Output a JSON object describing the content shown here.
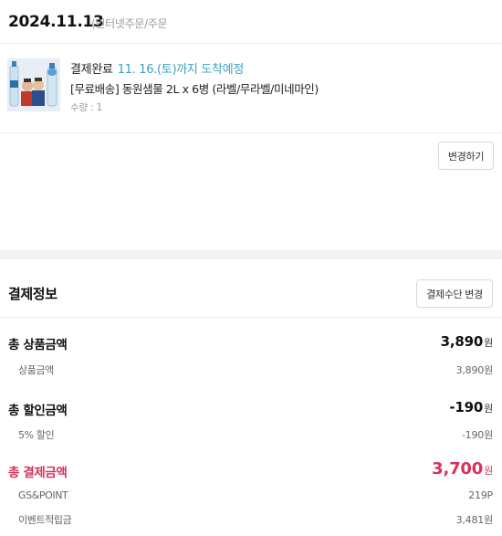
{
  "order": {
    "date": "2024.11.13",
    "type": "(인터넷주문/주문"
  },
  "item": {
    "status_label": "결제완료",
    "arrival": "11. 16.(토)까지 도착예정",
    "name": "[무료배송] 동원샘물 2L x 6병 (라벨/무라벨/미네마인)",
    "quantity": "수량 : 1",
    "change_button": "변경하기"
  },
  "payment": {
    "title": "결제정보",
    "change_method_button": "결제수단 변경",
    "rows": [
      {
        "label": "총 상품금액",
        "amount": "3,890",
        "unit": "원"
      },
      {
        "label": "상품금액",
        "amount": "3,890원"
      },
      {
        "label": "총 할인금액",
        "amount": "-190",
        "unit": "원"
      },
      {
        "label": "5% 할인",
        "amount": "-190원"
      },
      {
        "label": "총 결제금액",
        "amount": "3,700",
        "unit": "원"
      },
      {
        "label": "GS&POINT",
        "amount": "219P"
      },
      {
        "label": "이벤트적립금",
        "amount": "3,481원"
      }
    ]
  },
  "colors": {
    "accent_total": "#d6335a",
    "arrival_text": "#3aa0c0",
    "section_separator": "#f2f2f2"
  }
}
